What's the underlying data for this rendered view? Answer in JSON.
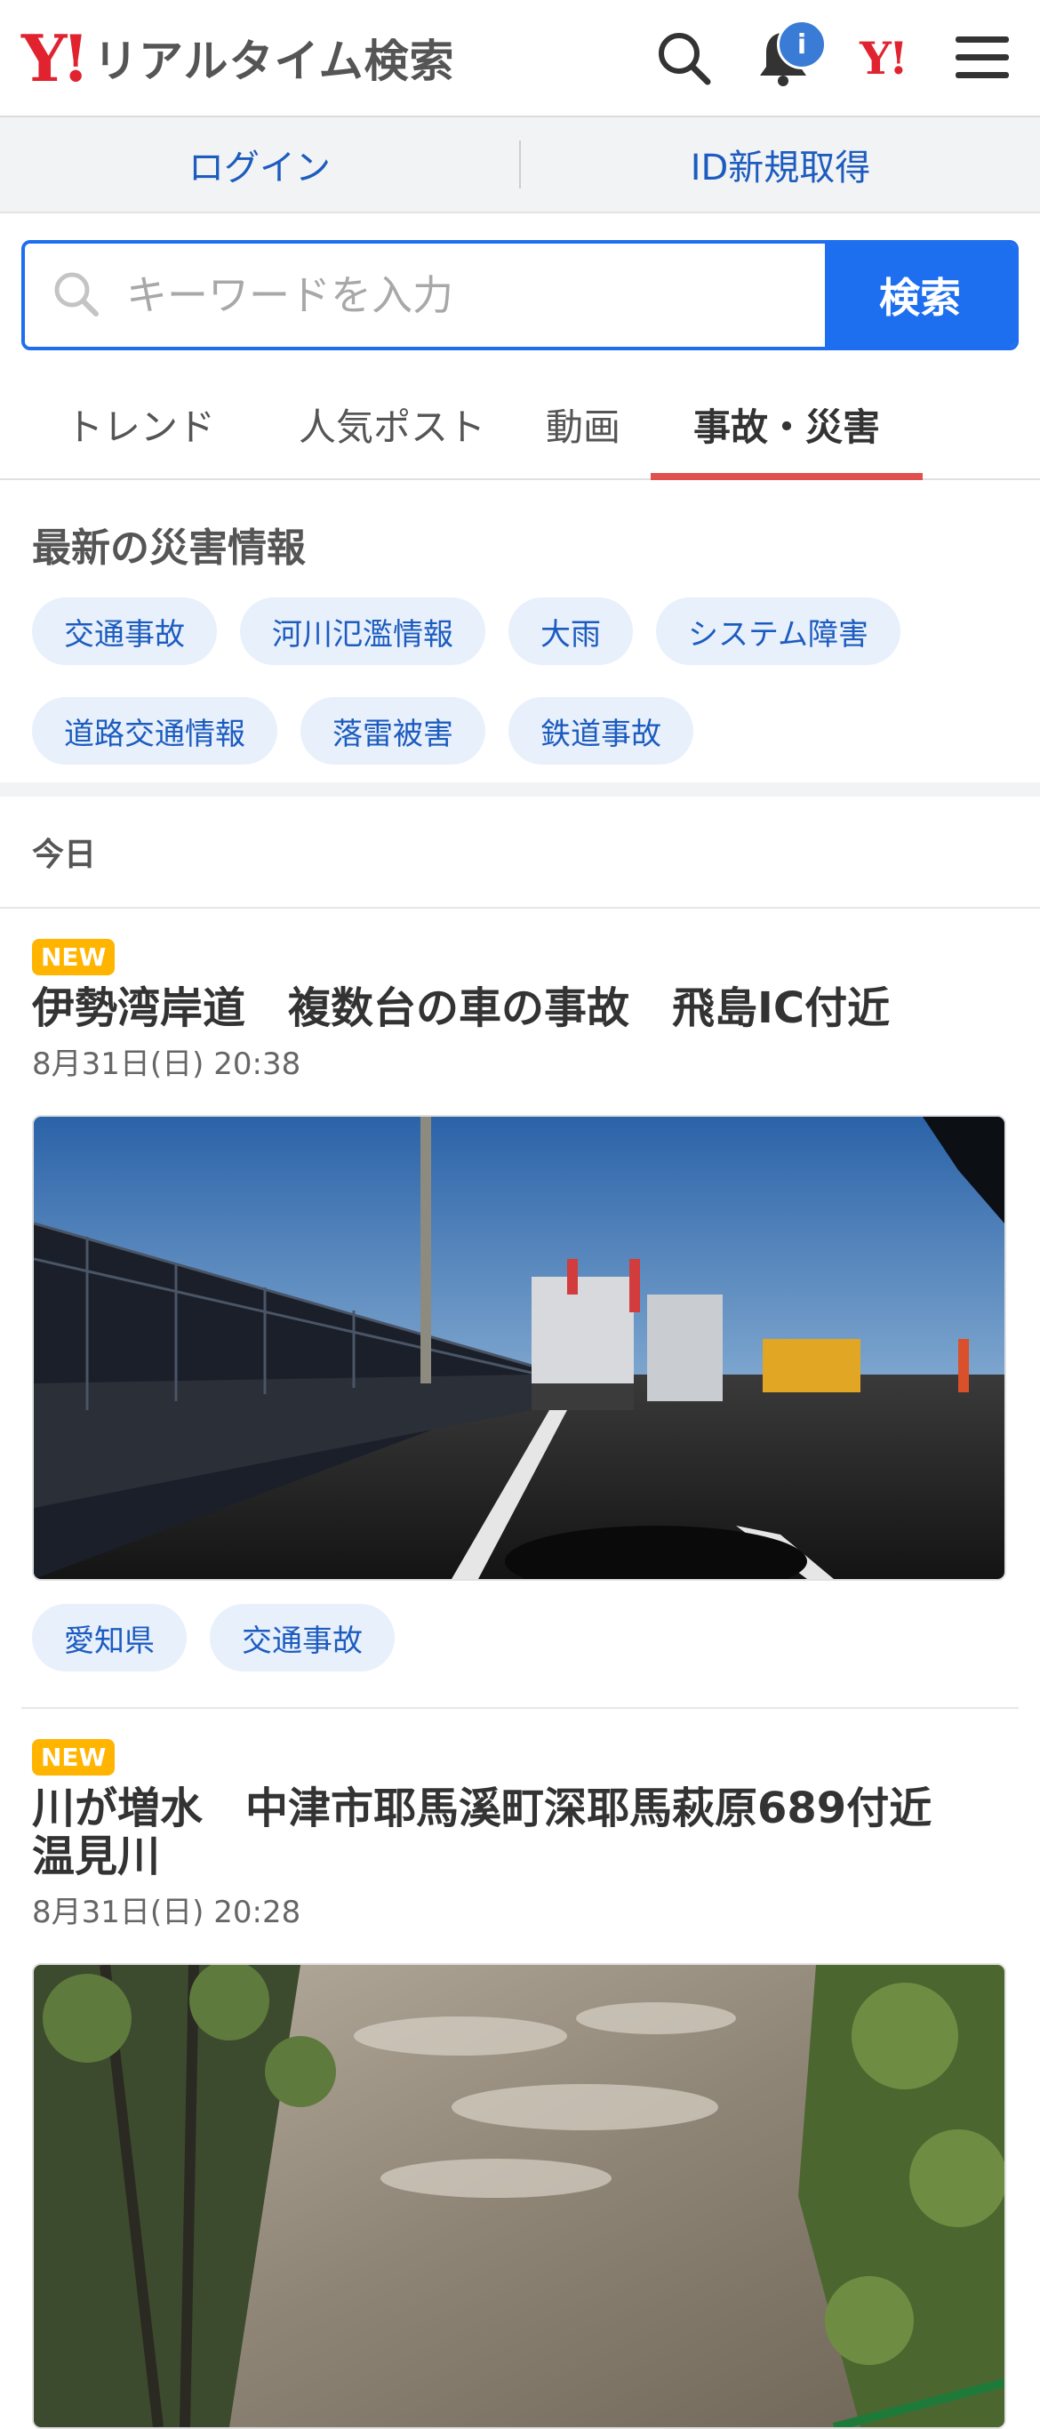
{
  "header": {
    "brand_mark": "Y!",
    "title": "リアルタイム検索",
    "notification_badge": "i",
    "yahoo_icon_text": "Y!"
  },
  "auth": {
    "login": "ログイン",
    "signup": "ID新規取得"
  },
  "search": {
    "placeholder": "キーワードを入力",
    "button": "検索"
  },
  "tabs": [
    {
      "label": "トレンド",
      "active": false
    },
    {
      "label": "人気ポスト",
      "active": false
    },
    {
      "label": "動画",
      "active": false
    },
    {
      "label": "事故・災害",
      "active": true
    }
  ],
  "disaster": {
    "title": "最新の災害情報",
    "tags": [
      "交通事故",
      "河川氾濫情報",
      "大雨",
      "システム障害",
      "道路交通情報",
      "落雷被害",
      "鉄道事故"
    ]
  },
  "day_label": "今日",
  "news": [
    {
      "badge": "NEW",
      "title": "伊勢湾岸道　複数台の車の事故　飛島IC付近",
      "time": "8月31日(日) 20:38",
      "tags": [
        "愛知県",
        "交通事故"
      ]
    },
    {
      "badge": "NEW",
      "title": "川が増水　中津市耶馬溪町深耶馬萩原689付近　温見川",
      "time": "8月31日(日) 20:28",
      "tags": []
    }
  ],
  "colors": {
    "accent": "#1e6ef0",
    "brand": "#e0232f",
    "tab_underline": "#e0504c",
    "new_badge": "#ffb400"
  }
}
